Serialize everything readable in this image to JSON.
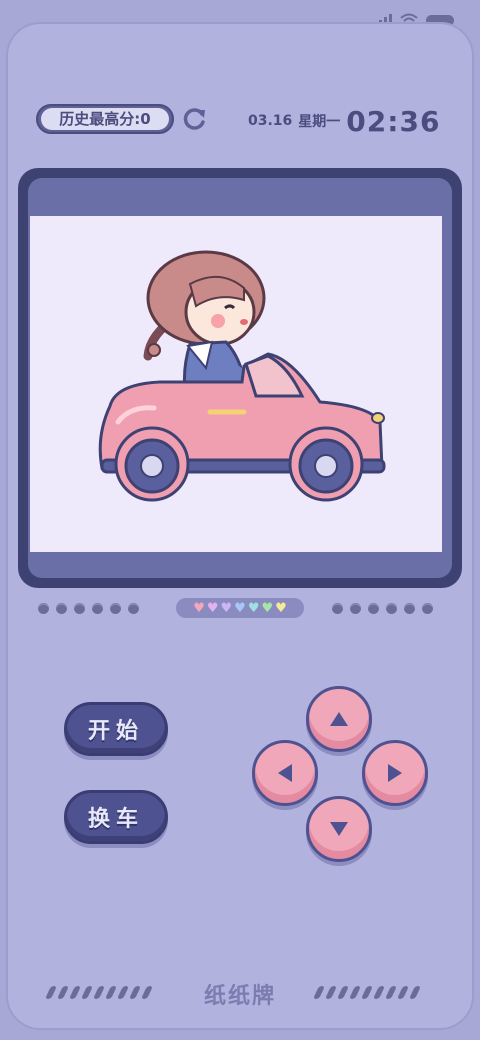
{
  "status_bar": {
    "icons": [
      "signal-icon",
      "wifi-icon",
      "battery-icon"
    ]
  },
  "header": {
    "high_score_label": "历史最高分:0",
    "date": "03.16",
    "weekday": "星期一",
    "time": "02:36"
  },
  "screen": {
    "illustration": "girl-driving-pink-car"
  },
  "indicator": {
    "hearts": [
      "#f4a6bf",
      "#e3b0f0",
      "#c9b6f7",
      "#a9c7f5",
      "#9fe0e0",
      "#a8e6a8",
      "#f3ec96"
    ]
  },
  "controls": {
    "start_label": "开始",
    "change_car_label": "换车"
  },
  "footer": {
    "brand": "纸纸牌"
  },
  "colors": {
    "background": "#a7a8d6",
    "frame": "#3e4273",
    "button": "#4f5290",
    "dpad": "#f0a7ba",
    "display": "#efeafb"
  }
}
